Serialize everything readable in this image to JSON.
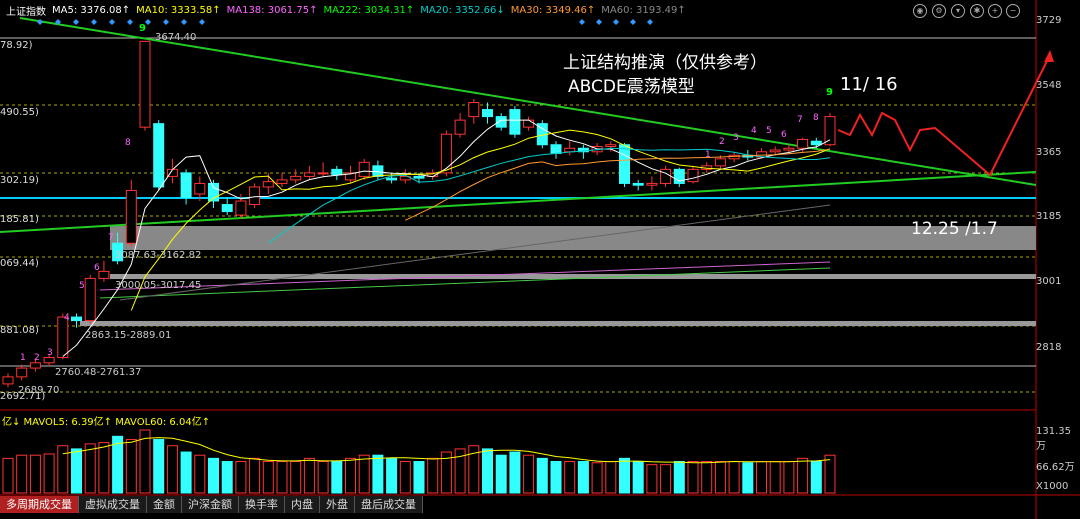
{
  "header": {
    "index_name": "上证指数",
    "ma_items": [
      {
        "label": "MA5: 3376.08↑",
        "color": "#ffffff"
      },
      {
        "label": "MA10: 3333.58↑",
        "color": "#ffff00"
      },
      {
        "label": "MA138: 3061.75↑",
        "color": "#ff66ff"
      },
      {
        "label": "MA222: 3034.31↑",
        "color": "#00ff00"
      },
      {
        "label": "MA20: 3352.66↓",
        "color": "#00cccc"
      },
      {
        "label": "MA30: 3349.46↑",
        "color": "#ff9933"
      },
      {
        "label": "MA60: 3193.49↑",
        "color": "#888888"
      }
    ]
  },
  "annotations": {
    "title_line1": "上证结构推演（仅供参考）",
    "title_line2": "ABCDE震荡模型",
    "date_label": "11/ 16",
    "range_label": "12.25 /1.7",
    "high_label": "3674.40",
    "box_label_1": "3087.63-3162.82",
    "box_label_2": "3000.05-3017.45",
    "box_label_3": "2863.15-2889.01",
    "box_label_4": "2760.48-2761.37",
    "low_label": "2689.70",
    "nine_top": "9",
    "nine_right": "9"
  },
  "price_axis": [
    "3729",
    "3548",
    "3365",
    "3185",
    "3001",
    "2818"
  ],
  "left_axis": [
    "78.92)",
    "490.55)",
    "302.19)",
    "185.81)",
    "069.44)",
    "881.08)",
    "2692.71)"
  ],
  "volume": {
    "header": "亿↓ MAVOL5: 6.39亿↑ MAVOL60: 6.04亿↑",
    "axis": [
      "131.35万",
      "66.62万",
      "X1000"
    ]
  },
  "tabs": [
    "多周期成交量",
    "虚拟成交量",
    "金额",
    "沪深金额",
    "换手率",
    "内盘",
    "外盘",
    "盘后成交量"
  ],
  "counter_labels": [
    "1",
    "2",
    "3",
    "4",
    "5",
    "6",
    "7",
    "8",
    "9"
  ],
  "candles": [
    {
      "o": 2700,
      "c": 2720,
      "h": 2730,
      "l": 2690
    },
    {
      "o": 2720,
      "c": 2745,
      "h": 2755,
      "l": 2710
    },
    {
      "o": 2745,
      "c": 2760,
      "h": 2770,
      "l": 2735
    },
    {
      "o": 2760,
      "c": 2775,
      "h": 2785,
      "l": 2750
    },
    {
      "o": 2775,
      "c": 2890,
      "h": 2900,
      "l": 2770
    },
    {
      "o": 2890,
      "c": 2880,
      "h": 2900,
      "l": 2860
    },
    {
      "o": 2880,
      "c": 3000,
      "h": 3010,
      "l": 2870
    },
    {
      "o": 3000,
      "c": 3020,
      "h": 3050,
      "l": 2990
    },
    {
      "o": 3100,
      "c": 3050,
      "h": 3130,
      "l": 3040
    },
    {
      "o": 3100,
      "c": 3250,
      "h": 3280,
      "l": 3090
    },
    {
      "o": 3430,
      "c": 3674,
      "h": 3674,
      "l": 3420
    },
    {
      "o": 3440,
      "c": 3260,
      "h": 3450,
      "l": 3250
    },
    {
      "o": 3290,
      "c": 3310,
      "h": 3340,
      "l": 3270
    },
    {
      "o": 3300,
      "c": 3230,
      "h": 3310,
      "l": 3210
    },
    {
      "o": 3240,
      "c": 3270,
      "h": 3290,
      "l": 3220
    },
    {
      "o": 3270,
      "c": 3220,
      "h": 3280,
      "l": 3200
    },
    {
      "o": 3210,
      "c": 3190,
      "h": 3230,
      "l": 3180
    },
    {
      "o": 3180,
      "c": 3220,
      "h": 3240,
      "l": 3170
    },
    {
      "o": 3210,
      "c": 3260,
      "h": 3270,
      "l": 3200
    },
    {
      "o": 3260,
      "c": 3275,
      "h": 3300,
      "l": 3240
    },
    {
      "o": 3270,
      "c": 3280,
      "h": 3300,
      "l": 3260
    },
    {
      "o": 3280,
      "c": 3290,
      "h": 3310,
      "l": 3270
    },
    {
      "o": 3290,
      "c": 3300,
      "h": 3320,
      "l": 3280
    },
    {
      "o": 3300,
      "c": 3300,
      "h": 3330,
      "l": 3290
    },
    {
      "o": 3310,
      "c": 3295,
      "h": 3320,
      "l": 3280
    },
    {
      "o": 3280,
      "c": 3300,
      "h": 3320,
      "l": 3270
    },
    {
      "o": 3290,
      "c": 3330,
      "h": 3340,
      "l": 3280
    },
    {
      "o": 3320,
      "c": 3290,
      "h": 3335,
      "l": 3280
    },
    {
      "o": 3285,
      "c": 3280,
      "h": 3300,
      "l": 3270
    },
    {
      "o": 3280,
      "c": 3290,
      "h": 3310,
      "l": 3270
    },
    {
      "o": 3290,
      "c": 3285,
      "h": 3300,
      "l": 3270
    },
    {
      "o": 3290,
      "c": 3300,
      "h": 3310,
      "l": 3280
    },
    {
      "o": 3300,
      "c": 3410,
      "h": 3420,
      "l": 3290
    },
    {
      "o": 3410,
      "c": 3450,
      "h": 3470,
      "l": 3400
    },
    {
      "o": 3460,
      "c": 3500,
      "h": 3510,
      "l": 3440
    },
    {
      "o": 3480,
      "c": 3460,
      "h": 3500,
      "l": 3440
    },
    {
      "o": 3460,
      "c": 3430,
      "h": 3470,
      "l": 3420
    },
    {
      "o": 3480,
      "c": 3410,
      "h": 3490,
      "l": 3400
    },
    {
      "o": 3430,
      "c": 3450,
      "h": 3460,
      "l": 3420
    },
    {
      "o": 3440,
      "c": 3380,
      "h": 3450,
      "l": 3370
    },
    {
      "o": 3380,
      "c": 3355,
      "h": 3390,
      "l": 3340
    },
    {
      "o": 3360,
      "c": 3370,
      "h": 3390,
      "l": 3350
    },
    {
      "o": 3370,
      "c": 3360,
      "h": 3380,
      "l": 3340
    },
    {
      "o": 3360,
      "c": 3375,
      "h": 3385,
      "l": 3350
    },
    {
      "o": 3375,
      "c": 3380,
      "h": 3390,
      "l": 3360
    },
    {
      "o": 3380,
      "c": 3270,
      "h": 3385,
      "l": 3260
    },
    {
      "o": 3270,
      "c": 3265,
      "h": 3280,
      "l": 3250
    },
    {
      "o": 3265,
      "c": 3270,
      "h": 3290,
      "l": 3250
    },
    {
      "o": 3270,
      "c": 3310,
      "h": 3320,
      "l": 3260
    },
    {
      "o": 3310,
      "c": 3270,
      "h": 3315,
      "l": 3260
    },
    {
      "o": 3275,
      "c": 3310,
      "h": 3320,
      "l": 3270
    },
    {
      "o": 3310,
      "c": 3320,
      "h": 3330,
      "l": 3300
    },
    {
      "o": 3320,
      "c": 3340,
      "h": 3350,
      "l": 3310
    },
    {
      "o": 3340,
      "c": 3350,
      "h": 3360,
      "l": 3330
    },
    {
      "o": 3350,
      "c": 3345,
      "h": 3365,
      "l": 3335
    },
    {
      "o": 3345,
      "c": 3360,
      "h": 3370,
      "l": 3340
    },
    {
      "o": 3360,
      "c": 3365,
      "h": 3375,
      "l": 3350
    },
    {
      "o": 3365,
      "c": 3370,
      "h": 3380,
      "l": 3355
    },
    {
      "o": 3370,
      "c": 3395,
      "h": 3400,
      "l": 3360
    },
    {
      "o": 3390,
      "c": 3380,
      "h": 3400,
      "l": 3370
    },
    {
      "o": 3380,
      "c": 3460,
      "h": 3470,
      "l": 3375
    }
  ],
  "volumes": [
    0.55,
    0.6,
    0.6,
    0.62,
    0.75,
    0.7,
    0.78,
    0.8,
    0.9,
    0.85,
    1.0,
    0.85,
    0.75,
    0.65,
    0.6,
    0.55,
    0.5,
    0.5,
    0.55,
    0.5,
    0.5,
    0.5,
    0.55,
    0.5,
    0.5,
    0.55,
    0.6,
    0.6,
    0.55,
    0.5,
    0.5,
    0.55,
    0.65,
    0.7,
    0.75,
    0.7,
    0.6,
    0.65,
    0.6,
    0.55,
    0.5,
    0.5,
    0.5,
    0.48,
    0.5,
    0.55,
    0.5,
    0.45,
    0.45,
    0.5,
    0.5,
    0.5,
    0.5,
    0.5,
    0.48,
    0.5,
    0.5,
    0.5,
    0.55,
    0.5,
    0.6
  ]
}
